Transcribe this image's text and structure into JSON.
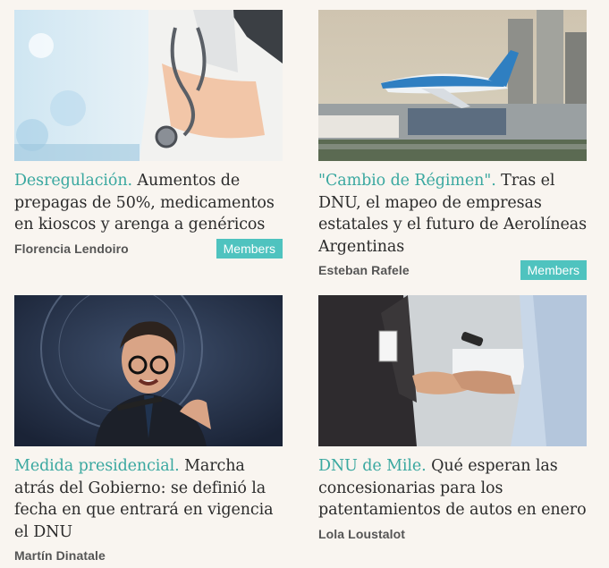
{
  "articles": [
    {
      "kicker": "Desregulación.",
      "headline": " Aumentos de prepagas de 50%, medicamentos en kioscos y arenga a genéricos",
      "author": "Florencia Lendoiro",
      "badge": "Members",
      "image": "doctor-with-stethoscope"
    },
    {
      "kicker": "\"Cambio de Régimen\".",
      "headline": " Tras el DNU, el mapeo de empresas estatales y el futuro de Aerolíneas Argentinas",
      "author": "Esteban Rafele",
      "badge": "Members",
      "image": "airplane-landing"
    },
    {
      "kicker": "Medida presidencial.",
      "headline": " Marcha atrás del Gobierno: se definió la fecha en que entrará en vigencia el DNU",
      "author": "Martín Dinatale",
      "image": "president-speech"
    },
    {
      "kicker": "DNU de Mile.",
      "headline": " Qué esperan las concesionarias para los patentamientos de autos en enero",
      "author": "Lola Loustalot",
      "image": "handshake-car-keys"
    }
  ],
  "colors": {
    "accent": "#3aa8a0",
    "badge_bg": "#4fc3bf",
    "background": "#f9f5f0"
  }
}
